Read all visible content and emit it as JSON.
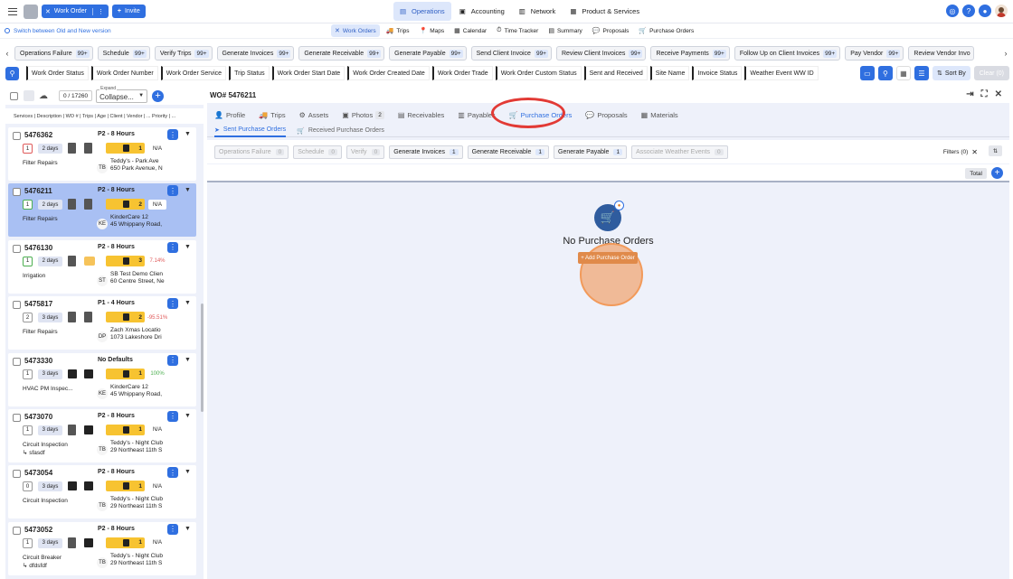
{
  "topbar": {
    "work_order_btn": "Work Order",
    "invite_btn": "Invite",
    "nav": [
      {
        "label": "Operations",
        "icon": "clipboard-icon",
        "active": true
      },
      {
        "label": "Accounting",
        "icon": "accounting-icon",
        "active": false
      },
      {
        "label": "Network",
        "icon": "network-icon",
        "active": false
      },
      {
        "label": "Product & Services",
        "icon": "product-icon",
        "active": false
      }
    ]
  },
  "subbar": {
    "switch_text": "Switch between Old and New version",
    "nav": [
      {
        "label": "Work Orders",
        "glyph": "✕",
        "active": true
      },
      {
        "label": "Trips",
        "glyph": "🚚",
        "active": false
      },
      {
        "label": "Maps",
        "glyph": "📍",
        "active": false
      },
      {
        "label": "Calendar",
        "glyph": "▦",
        "active": false
      },
      {
        "label": "Time Tracker",
        "glyph": "⏱",
        "active": false
      },
      {
        "label": "Summary",
        "glyph": "▤",
        "active": false
      },
      {
        "label": "Proposals",
        "glyph": "💬",
        "active": false
      },
      {
        "label": "Purchase Orders",
        "glyph": "🛒",
        "active": false
      }
    ]
  },
  "stages": [
    {
      "label": "Operations Failure",
      "count": "99+"
    },
    {
      "label": "Schedule",
      "count": "99+"
    },
    {
      "label": "Verify Trips",
      "count": "99+"
    },
    {
      "label": "Generate Invoices",
      "count": "99+"
    },
    {
      "label": "Generate Receivable",
      "count": "99+"
    },
    {
      "label": "Generate Payable",
      "count": "99+"
    },
    {
      "label": "Send Client Invoice",
      "count": "99+"
    },
    {
      "label": "Review Client Invoices",
      "count": "99+"
    },
    {
      "label": "Receive Payments",
      "count": "99+"
    },
    {
      "label": "Follow Up on Client Invoices",
      "count": "99+"
    },
    {
      "label": "Pay Vendor",
      "count": "99+"
    },
    {
      "label": "Review Vendor Invo",
      "count": ""
    }
  ],
  "filters": [
    "Work Order Status",
    "Work Order Number",
    "Work Order Service",
    "Trip Status",
    "Work Order Start Date",
    "Work Order Created Date",
    "Work Order Trade",
    "Work Order Custom Status",
    "Sent and Received",
    "Site Name",
    "Invoice Status",
    "Weather Event WW ID"
  ],
  "filter_right": {
    "sort_by": "Sort By",
    "clear_all": "Clear (0)"
  },
  "list_header": {
    "count": "0 / 17260",
    "expand_label": "Expand",
    "expand_value": "Collapse...",
    "columns": "Services | Description | WO # | Trips | Age | Client | Vendor | ... Priority | ..."
  },
  "work_orders": [
    {
      "wo": "5476362",
      "priority": "P2 - 8 Hours",
      "trips": "1",
      "tripcls": "red",
      "age": "2 days",
      "icon1": "doc",
      "icon2": "doc",
      "yel": "1",
      "pct": "N/A",
      "pctcls": "na",
      "service": "Filter Repairs",
      "service2": "",
      "initials": "TB",
      "client1": "Teddy's - Park Ave",
      "client2": "650 Park Avenue, N",
      "selected": false
    },
    {
      "wo": "5476211",
      "priority": "P2 - 8 Hours",
      "trips": "1",
      "tripcls": "green",
      "age": "2 days",
      "icon1": "doc",
      "icon2": "doc",
      "yel": "2",
      "pct": "N/A",
      "pctcls": "na",
      "service": "Filter Repairs",
      "service2": "",
      "initials": "KE",
      "client1": "KinderCare 12",
      "client2": "45 Whippany Road,",
      "selected": true
    },
    {
      "wo": "5476130",
      "priority": "P2 - 8 Hours",
      "trips": "1",
      "tripcls": "green",
      "age": "2 days",
      "icon1": "doc",
      "icon2": "env",
      "yel": "3",
      "pct": "7.14%",
      "pctcls": "red",
      "service": "Irrigation",
      "service2": "",
      "initials": "ST",
      "client1": "SB Test Demo Clien",
      "client2": "60 Centre Street, Ne",
      "selected": false
    },
    {
      "wo": "5475817",
      "priority": "P1 - 4 Hours",
      "trips": "2",
      "tripcls": "",
      "age": "3 days",
      "icon1": "doc",
      "icon2": "doc",
      "yel": "2",
      "pct": "-95.51%",
      "pctcls": "red",
      "service": "Filter Repairs",
      "service2": "",
      "initials": "DP",
      "client1": "Zach Xmas Locatio",
      "client2": "1073 Lakeshore Dri",
      "selected": false
    },
    {
      "wo": "5473330",
      "priority": "No Defaults",
      "trips": "1",
      "tripcls": "",
      "age": "3 days",
      "icon1": "sq",
      "icon2": "sq",
      "yel": "1",
      "pct": "100%",
      "pctcls": "green",
      "service": "HVAC PM Inspec...",
      "service2": "",
      "initials": "KE",
      "client1": "KinderCare 12",
      "client2": "45 Whippany Road,",
      "selected": false
    },
    {
      "wo": "5473070",
      "priority": "P2 - 8 Hours",
      "trips": "1",
      "tripcls": "",
      "age": "3 days",
      "icon1": "doc",
      "icon2": "sq",
      "yel": "1",
      "pct": "N/A",
      "pctcls": "na",
      "service": "Circuit Inspection",
      "service2": "↳ sfasdf",
      "initials": "TB",
      "client1": "Teddy's - Night Club",
      "client2": "29 Northeast 11th S",
      "selected": false
    },
    {
      "wo": "5473054",
      "priority": "P2 - 8 Hours",
      "trips": "0",
      "tripcls": "",
      "age": "3 days",
      "icon1": "sq",
      "icon2": "sq",
      "yel": "1",
      "pct": "N/A",
      "pctcls": "na",
      "service": "Circuit Inspection",
      "service2": "",
      "initials": "TB",
      "client1": "Teddy's - Night Club",
      "client2": "29 Northeast 11th S",
      "selected": false
    },
    {
      "wo": "5473052",
      "priority": "P2 - 8 Hours",
      "trips": "1",
      "tripcls": "",
      "age": "3 days",
      "icon1": "doc",
      "icon2": "sq",
      "yel": "1",
      "pct": "N/A",
      "pctcls": "na",
      "service": "Circuit Breaker",
      "service2": "↳ dfdsfdf",
      "initials": "TB",
      "client1": "Teddy's - Night Club",
      "client2": "29 Northeast 11th S",
      "selected": false
    }
  ],
  "detail": {
    "title": "WO# 5476211",
    "tabs": [
      {
        "label": "Profile",
        "glyph": "👤",
        "badge": ""
      },
      {
        "label": "Trips",
        "glyph": "🚚",
        "badge": ""
      },
      {
        "label": "Assets",
        "glyph": "⚙",
        "badge": ""
      },
      {
        "label": "Photos",
        "glyph": "▣",
        "badge": "2"
      },
      {
        "label": "Receivables",
        "glyph": "▤",
        "badge": ""
      },
      {
        "label": "Payables",
        "glyph": "▥",
        "badge": ""
      },
      {
        "label": "Purchase Orders",
        "glyph": "🛒",
        "badge": "",
        "active": true
      },
      {
        "label": "Proposals",
        "glyph": "💬",
        "badge": ""
      },
      {
        "label": "Materials",
        "glyph": "▦",
        "badge": ""
      }
    ],
    "subtabs": [
      {
        "label": "Sent Purchase Orders",
        "glyph": "➤",
        "active": true
      },
      {
        "label": "Received Purchase Orders",
        "glyph": "🛒",
        "active": false
      }
    ],
    "po_stages": [
      {
        "label": "Operations Failure",
        "count": "0",
        "disabled": true
      },
      {
        "label": "Schedule",
        "count": "0",
        "disabled": true
      },
      {
        "label": "Verify",
        "count": "0",
        "disabled": true
      },
      {
        "label": "Generate Invoices",
        "count": "1",
        "disabled": false
      },
      {
        "label": "Generate Receivable",
        "count": "1",
        "disabled": false
      },
      {
        "label": "Generate Payable",
        "count": "1",
        "disabled": false
      },
      {
        "label": "Associate Weather Events",
        "count": "0",
        "disabled": true
      }
    ],
    "filters_label": "Filters (0)",
    "total_label": "Total",
    "empty_title": "No Purchase Orders",
    "add_po_label": "+ Add Purchase Order"
  }
}
